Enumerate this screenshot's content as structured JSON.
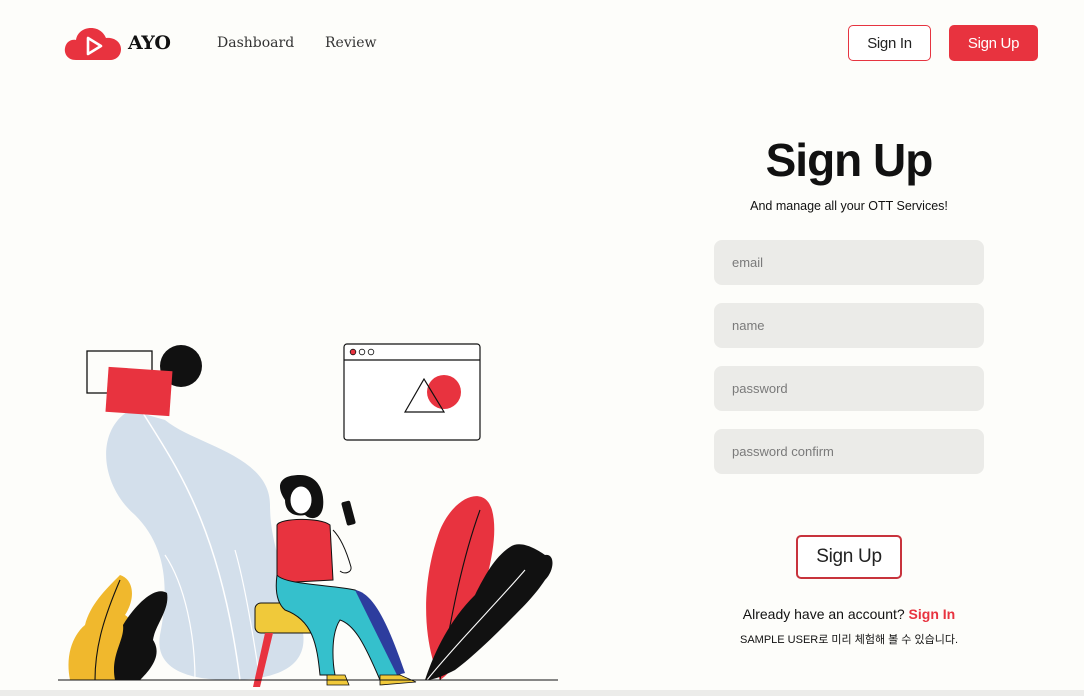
{
  "brand": {
    "name": "AYO",
    "logo_icon": "cloud-play-icon",
    "accent": "#e8333f"
  },
  "nav": {
    "items": [
      {
        "label": "Dashboard"
      },
      {
        "label": "Review"
      }
    ]
  },
  "header_actions": {
    "signin_label": "Sign In",
    "signup_label": "Sign Up"
  },
  "form": {
    "title": "Sign Up",
    "subtitle": "And manage all your OTT Services!",
    "fields": {
      "email_placeholder": "email",
      "name_placeholder": "name",
      "password_placeholder": "password",
      "password_confirm_placeholder": "password confirm"
    },
    "submit_label": "Sign Up",
    "already_text": "Already have an account?",
    "signin_link": "Sign In",
    "sample_note": "SAMPLE USER로 미리 체험해 볼 수 있습니다."
  }
}
